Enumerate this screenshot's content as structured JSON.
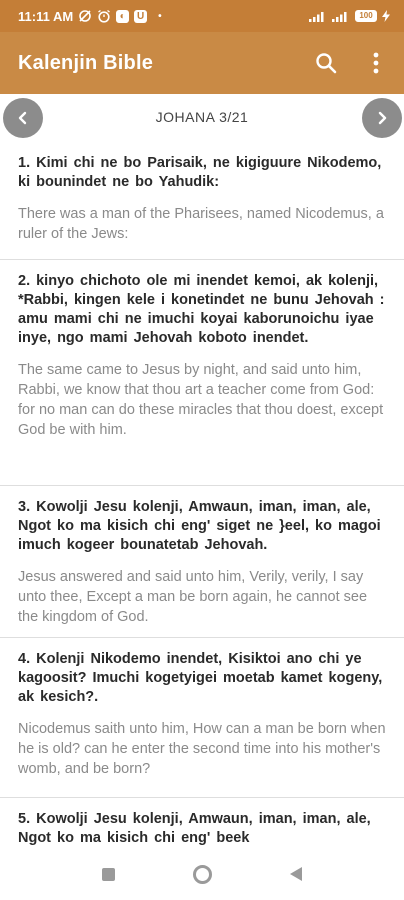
{
  "status_bar": {
    "time": "11:11 AM",
    "battery": "100"
  },
  "app": {
    "title": "Kalenjin Bible",
    "search_icon": "search-icon",
    "menu_icon": "more-vertical-icon"
  },
  "chapter": {
    "reference": "JOHANA 3/21"
  },
  "verses": [
    {
      "kalenjin": "1. Kimi  chi ne bo Parisaik,  ne kigiguure  Nikodemo,  ki bounindet   ne  bo  Yahudik:",
      "english": "There was a man of the Pharisees, named Nicodemus, a ruler of the Jews:"
    },
    {
      "kalenjin": "2. kinyo  chichoto   ole mi  inendet kemoi,  ak kolenji,  *Rabbi,  kingen  kele  i konetindet   ne bunu Jehovah :  amu  mami  chi  ne  imuchi  koyai  kaborunoichu   iyae inye,   ngo  mami  Jehovah   koboto    inendet.",
      "english": "The same came to Jesus by night, and said unto him, Rabbi, we know that thou art a teacher come from God: for no man can do these miracles that thou doest, except God be with him."
    },
    {
      "kalenjin": "3. Kowolji   Jesu kolenji,   Amwaun,   iman,   iman, ale,  Ngot   ko  ma  kisich   chi eng'  siget ne }eel, ko magoi imuch  kogeer bounatetab   Jehovah.",
      "english": "Jesus answered and said unto him, Verily, verily, I say unto thee, Except a man be born again, he cannot see the kingdom of God."
    },
    {
      "kalenjin": "4. Kolenji  Nikodemo   inendet,  Kisiktoi   ano chi  ye  kagoosit? Imuchi   kogetyigei  moetab kamet  kogeny,  ak  kesich?.",
      "english": "Nicodemus saith unto him, How can a man be born when he is old? can he enter the second time into his mother's womb, and be born?"
    },
    {
      "kalenjin": "5. Kowolji  Jesu   kolenji,  Amwaun,   iman, iman,  ale,  Ngot   ko  ma kisich chi eng'  beek",
      "english": ""
    }
  ],
  "colors": {
    "status_bar": "#c47e37",
    "app_bar": "#c98a45",
    "nav_button": "#8c8c8c"
  }
}
